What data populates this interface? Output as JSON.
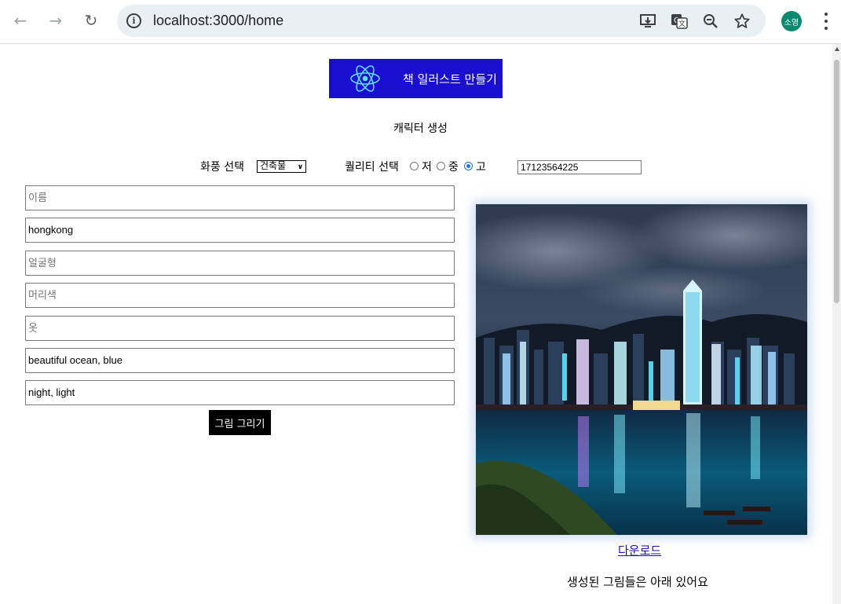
{
  "browser": {
    "url": "localhost:3000/home",
    "profile_initials": "소영"
  },
  "banner": {
    "title": "책 일러스트 만들기"
  },
  "subtitle": "캐릭터 생성",
  "controls": {
    "style_label": "화풍 선택",
    "style_selected": "건축물",
    "quality_label": "퀄리티 선택",
    "quality_options": [
      "저",
      "중",
      "고"
    ],
    "quality_selected": "고",
    "seed_value": "17123564225"
  },
  "form": {
    "fields": [
      {
        "placeholder": "이름",
        "value": ""
      },
      {
        "placeholder": "",
        "value": "hongkong"
      },
      {
        "placeholder": "얼굴형",
        "value": ""
      },
      {
        "placeholder": "머리색",
        "value": ""
      },
      {
        "placeholder": "옷",
        "value": ""
      },
      {
        "placeholder": "",
        "value": "beautiful ocean, blue"
      },
      {
        "placeholder": "",
        "value": "night, light"
      }
    ],
    "submit_label": "그림 그리기"
  },
  "result": {
    "download_label": "다운로드",
    "below_note": "생성된 그림들은 아래 있어요"
  },
  "colors": {
    "banner_bg": "#1a0fd0",
    "react_logo": "#61dafb",
    "button_bg": "#000000",
    "link": "#1a0dab"
  },
  "icons": [
    "back-arrow-icon",
    "forward-arrow-icon",
    "reload-icon",
    "info-icon",
    "install-app-icon",
    "translate-icon",
    "zoom-icon",
    "bookmark-star-icon",
    "menu-dots-icon",
    "react-logo-icon"
  ]
}
